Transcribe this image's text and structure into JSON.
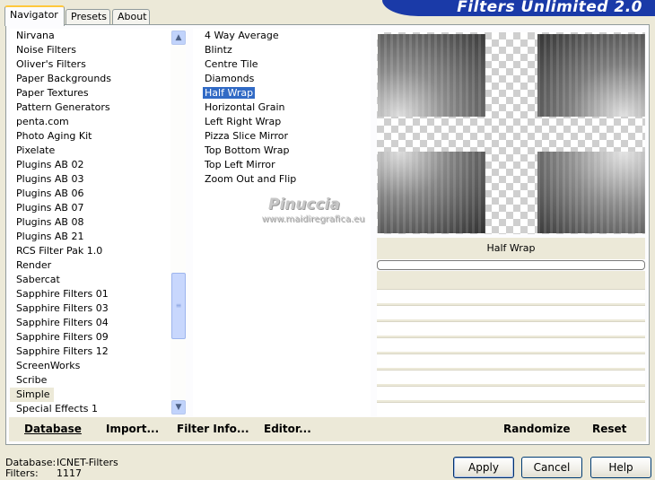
{
  "app": {
    "title": "Filters Unlimited 2.0"
  },
  "tabs": [
    {
      "label": "Navigator",
      "active": true
    },
    {
      "label": "Presets",
      "active": false
    },
    {
      "label": "About",
      "active": false
    }
  ],
  "categories": [
    "Nirvana",
    "Noise Filters",
    "Oliver's Filters",
    "Paper Backgrounds",
    "Paper Textures",
    "Pattern Generators",
    "penta.com",
    "Photo Aging Kit",
    "Pixelate",
    "Plugins AB 02",
    "Plugins AB 03",
    "Plugins AB 06",
    "Plugins AB 07",
    "Plugins AB 08",
    "Plugins AB 21",
    "RCS Filter Pak 1.0",
    "Render",
    "Sabercat",
    "Sapphire Filters 01",
    "Sapphire Filters 03",
    "Sapphire Filters 04",
    "Sapphire Filters 09",
    "Sapphire Filters 12",
    "ScreenWorks",
    "Scribe",
    "Simple",
    "Special Effects 1"
  ],
  "selected_category": "Simple",
  "filters": [
    "4 Way Average",
    "Blintz",
    "Centre Tile",
    "Diamonds",
    "Half Wrap",
    "Horizontal Grain",
    "Left Right Wrap",
    "Pizza Slice Mirror",
    "Top Bottom Wrap",
    "Top Left Mirror",
    "Zoom Out and Flip"
  ],
  "selected_filter": "Half Wrap",
  "watermark": {
    "name": "Pinuccia",
    "url": "www.maidiregrafica.eu"
  },
  "preview": {
    "filter_name": "Half Wrap",
    "progress": 0
  },
  "panel_buttons": {
    "database": "Database",
    "import": "Import...",
    "filter_info": "Filter Info...",
    "editor": "Editor...",
    "randomize": "Randomize",
    "reset": "Reset"
  },
  "status": {
    "database_label": "Database:",
    "database_value": "ICNET-Filters",
    "filters_label": "Filters:",
    "filters_value": "1117"
  },
  "dialog_buttons": {
    "apply": "Apply",
    "cancel": "Cancel",
    "help": "Help"
  },
  "colors": {
    "banner": "#1a3aa8",
    "selection": "#316ac5",
    "face": "#ece9d8"
  }
}
